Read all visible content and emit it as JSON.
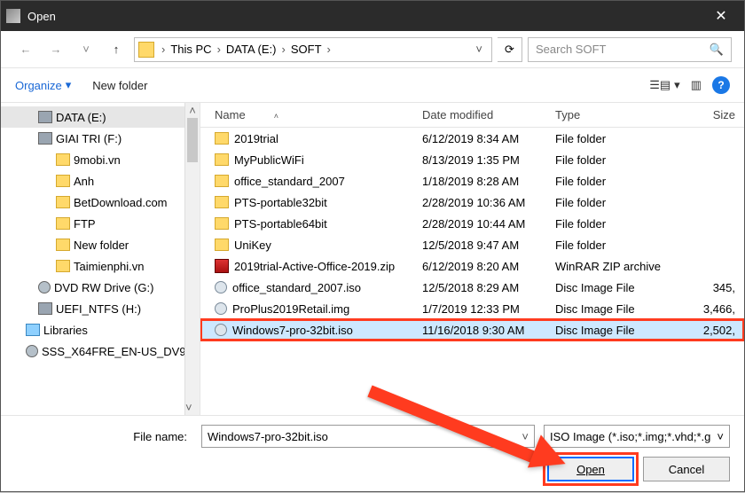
{
  "window": {
    "title": "Open"
  },
  "breadcrumb": {
    "items": [
      "This PC",
      "DATA (E:)",
      "SOFT"
    ]
  },
  "search": {
    "placeholder": "Search SOFT"
  },
  "toolbar": {
    "organize": "Organize",
    "new_folder": "New folder"
  },
  "tree": {
    "items": [
      {
        "label": "DATA (E:)",
        "icon": "drive",
        "indent": 1,
        "selected": true
      },
      {
        "label": "GIAI TRI (F:)",
        "icon": "drive",
        "indent": 1
      },
      {
        "label": "9mobi.vn",
        "icon": "folder",
        "indent": 2
      },
      {
        "label": "Anh",
        "icon": "folder",
        "indent": 2
      },
      {
        "label": "BetDownload.com",
        "icon": "folder",
        "indent": 2
      },
      {
        "label": "FTP",
        "icon": "folder",
        "indent": 2
      },
      {
        "label": "New folder",
        "icon": "folder",
        "indent": 2
      },
      {
        "label": "Taimienphi.vn",
        "icon": "folder",
        "indent": 2
      },
      {
        "label": "DVD RW Drive (G:)",
        "icon": "disc",
        "indent": 1
      },
      {
        "label": "UEFI_NTFS (H:)",
        "icon": "drive",
        "indent": 1
      },
      {
        "label": "Libraries",
        "icon": "lib",
        "indent": 0
      },
      {
        "label": "SSS_X64FRE_EN-US_DV9",
        "icon": "disc",
        "indent": 0
      }
    ]
  },
  "columns": {
    "name": "Name",
    "date": "Date modified",
    "type": "Type",
    "size": "Size"
  },
  "files": [
    {
      "name": "2019trial",
      "date": "6/12/2019 8:34 AM",
      "type": "File folder",
      "size": "",
      "icon": "folder"
    },
    {
      "name": "MyPublicWiFi",
      "date": "8/13/2019 1:35 PM",
      "type": "File folder",
      "size": "",
      "icon": "folder"
    },
    {
      "name": "office_standard_2007",
      "date": "1/18/2019 8:28 AM",
      "type": "File folder",
      "size": "",
      "icon": "folder"
    },
    {
      "name": "PTS-portable32bit",
      "date": "2/28/2019 10:36 AM",
      "type": "File folder",
      "size": "",
      "icon": "folder"
    },
    {
      "name": "PTS-portable64bit",
      "date": "2/28/2019 10:44 AM",
      "type": "File folder",
      "size": "",
      "icon": "folder"
    },
    {
      "name": "UniKey",
      "date": "12/5/2018 9:47 AM",
      "type": "File folder",
      "size": "",
      "icon": "folder"
    },
    {
      "name": "2019trial-Active-Office-2019.zip",
      "date": "6/12/2019 8:20 AM",
      "type": "WinRAR ZIP archive",
      "size": "",
      "icon": "zip"
    },
    {
      "name": "office_standard_2007.iso",
      "date": "12/5/2018 8:29 AM",
      "type": "Disc Image File",
      "size": "345,",
      "icon": "disc"
    },
    {
      "name": "ProPlus2019Retail.img",
      "date": "1/7/2019 12:33 PM",
      "type": "Disc Image File",
      "size": "3,466,",
      "icon": "disc"
    },
    {
      "name": "Windows7-pro-32bit.iso",
      "date": "11/16/2018 9:30 AM",
      "type": "Disc Image File",
      "size": "2,502,",
      "icon": "disc",
      "selected": true,
      "highlight": true
    }
  ],
  "filename": {
    "label": "File name:",
    "value": "Windows7-pro-32bit.iso"
  },
  "filter": {
    "value": "ISO Image (*.iso;*.img;*.vhd;*.g"
  },
  "buttons": {
    "open": "Open",
    "cancel": "Cancel"
  }
}
